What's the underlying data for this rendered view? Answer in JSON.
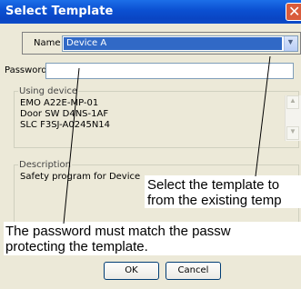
{
  "window": {
    "title": "Select Template",
    "close_glyph": "✕"
  },
  "form": {
    "name_label": "Name :",
    "name_value": "Device A",
    "password_label": "Password :",
    "password_value": "",
    "using_device_label": "Using device",
    "devices": [
      "EMO  A22E-MP-01",
      "Door SW  D4NS-1AF",
      "SLC  F3SJ-A0245N14"
    ],
    "description_label": "Description",
    "description_value": "Safety program for Device"
  },
  "buttons": {
    "ok": "OK",
    "cancel": "Cancel"
  },
  "callouts": {
    "template": [
      "Select the template to",
      "from the existing temp"
    ],
    "password": [
      "The password must match the passw",
      "protecting the template."
    ]
  },
  "icons": {
    "dropdown": "chevron-down-icon",
    "scroll_up": "arrow-up-icon",
    "scroll_down": "arrow-down-icon",
    "close": "close-icon"
  }
}
